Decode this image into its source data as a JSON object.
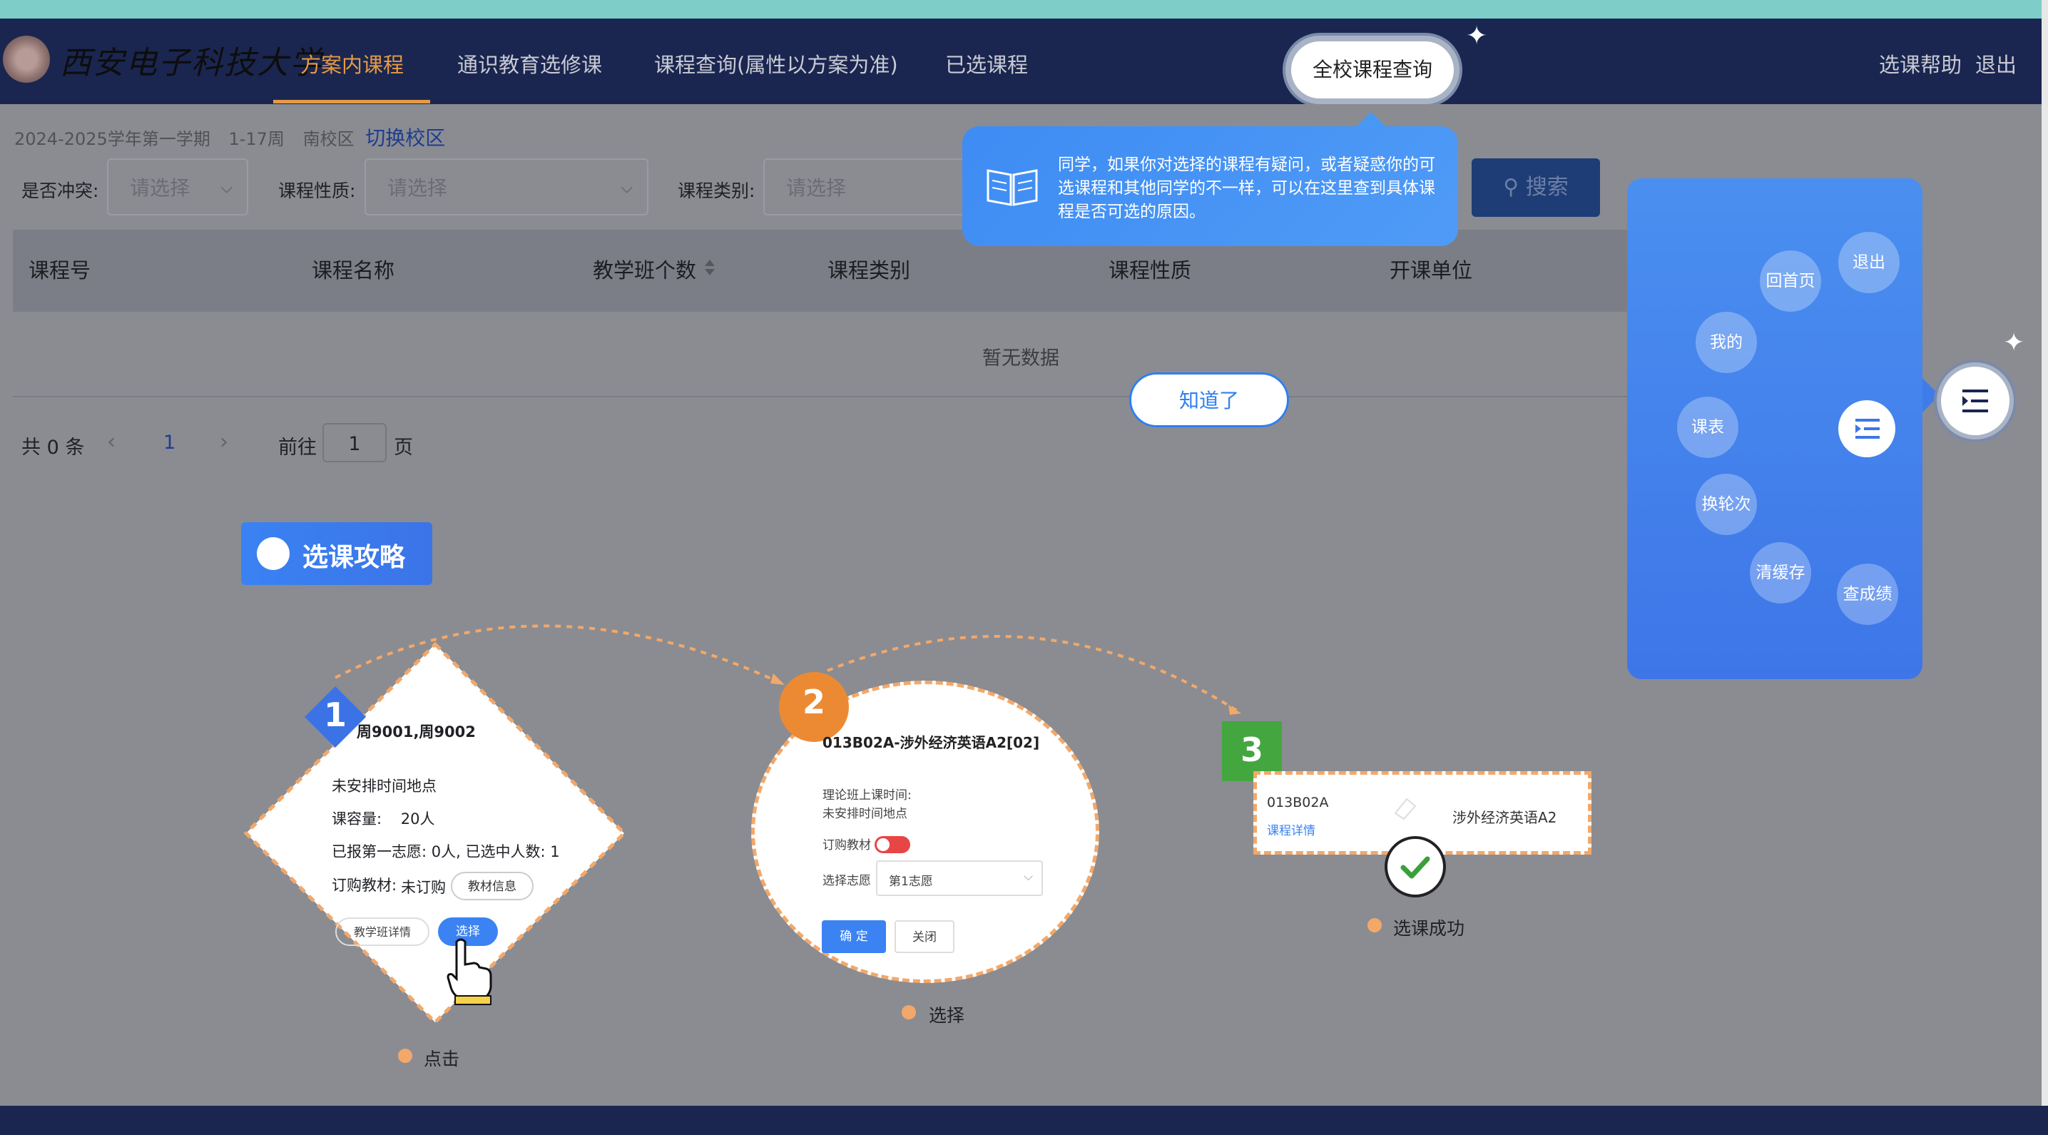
{
  "top_nav": {
    "logo_text": "西安电子科技大学",
    "items": [
      "方案内课程",
      "通识教育选修课",
      "课程查询(属性以方案为准)",
      "已选课程"
    ],
    "active_index": 0,
    "highlight_button": "全校课程查询",
    "help": "选课帮助",
    "logout": "退出"
  },
  "term_bar": {
    "term": "2024-2025学年第一学期",
    "weeks": "1-17周",
    "campus": "南校区",
    "switch_campus": "切换校区"
  },
  "filters": {
    "conflict_label": "是否冲突:",
    "conflict_placeholder": "请选择",
    "nature_label": "课程性质:",
    "nature_placeholder": "请选择",
    "category_label": "课程类别:",
    "category_placeholder": "请选择",
    "search_button": "搜索"
  },
  "table": {
    "columns": [
      "课程号",
      "课程名称",
      "教学班个数",
      "课程类别",
      "课程性质",
      "开课单位"
    ],
    "empty_text": "暂无数据"
  },
  "pager": {
    "total": "共 0 条",
    "current_page": "1",
    "goto_prefix": "前往",
    "goto_value": "1",
    "goto_suffix": "页"
  },
  "tooltip": {
    "text": "同学，如果你对选择的课程有疑问，或者疑惑你的可选课程和其他同学的不一样，可以在这里查到具体课程是否可选的原因。",
    "confirm": "知道了"
  },
  "guide": {
    "title": "选课攻略",
    "step1": {
      "num": "1",
      "header": "周9001,周9002",
      "time": "未安排时间地点",
      "capacity_label": "课容量:",
      "capacity_value": "20人",
      "enrolled": "已报第一志愿: 0人, 已选中人数: 1",
      "textbook_label": "订购教材:",
      "textbook_value": "未订购",
      "textbook_btn": "教材信息",
      "detail_btn": "教学班详情",
      "select_btn": "选择",
      "caption": "点击"
    },
    "step2": {
      "num": "2",
      "course": "013B02A-涉外经济英语A2[02]",
      "theory_time": "理论班上课时间:",
      "time_value": "未安排时间地点",
      "textbook_label": "订购教材",
      "wish_label": "选择志愿",
      "wish_value": "第1志愿",
      "confirm": "确 定",
      "close": "关闭",
      "caption": "选择"
    },
    "step3": {
      "num": "3",
      "code": "013B02A",
      "detail_link": "课程详情",
      "name": "涉外经济英语A2",
      "caption": "选课成功"
    }
  },
  "quick_menu": {
    "items": [
      "回首页",
      "退出",
      "我的",
      "课表",
      "换轮次",
      "清缓存",
      "查成绩"
    ]
  },
  "colors": {
    "nav_bg": "#1a2650",
    "accent": "#e69a45",
    "primary": "#3e8cf4",
    "dashed": "#f3a869"
  }
}
